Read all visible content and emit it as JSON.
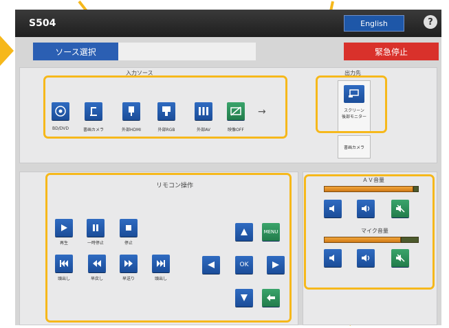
{
  "header": {
    "room": "S504",
    "language_button": "English",
    "help_icon": "?"
  },
  "nav": {
    "source_select": "ソース選択",
    "emergency_stop": "緊急停止"
  },
  "source_panel": {
    "title": "入力ソース",
    "sources": [
      {
        "label": "BD/DVD",
        "icon": "disc-icon"
      },
      {
        "label": "書画カメラ",
        "icon": "document-camera-icon"
      },
      {
        "label": "外部HDMI",
        "icon": "hdmi-icon"
      },
      {
        "label": "外部RGB",
        "icon": "rgb-icon"
      },
      {
        "label": "外部AV",
        "icon": "av-icon"
      },
      {
        "label": "映像OFF",
        "icon": "video-off-icon"
      }
    ],
    "arrow": "→"
  },
  "output_panel": {
    "title": "出力先",
    "screen_label": "スクリーン\n後部モニター",
    "doc_camera_label": "書画カメラ"
  },
  "remote_panel": {
    "title": "リモコン操作",
    "labels": {
      "play": "再生",
      "pause": "一時停止",
      "stop": "停止",
      "prev": "頭出し",
      "rew": "早戻し",
      "ff": "早送り",
      "next": "頭出し"
    },
    "menu": "MENU",
    "ok": "OK"
  },
  "audio_panel": {
    "av_title": "ＡＶ音量",
    "av_level": 0.93,
    "mic_title": "マイク音量",
    "mic_level": 0.8
  },
  "colors": {
    "highlight": "#f6b81b",
    "button_blue": "#2156a8",
    "green": "#2f8f5a",
    "red": "#d9312b"
  }
}
